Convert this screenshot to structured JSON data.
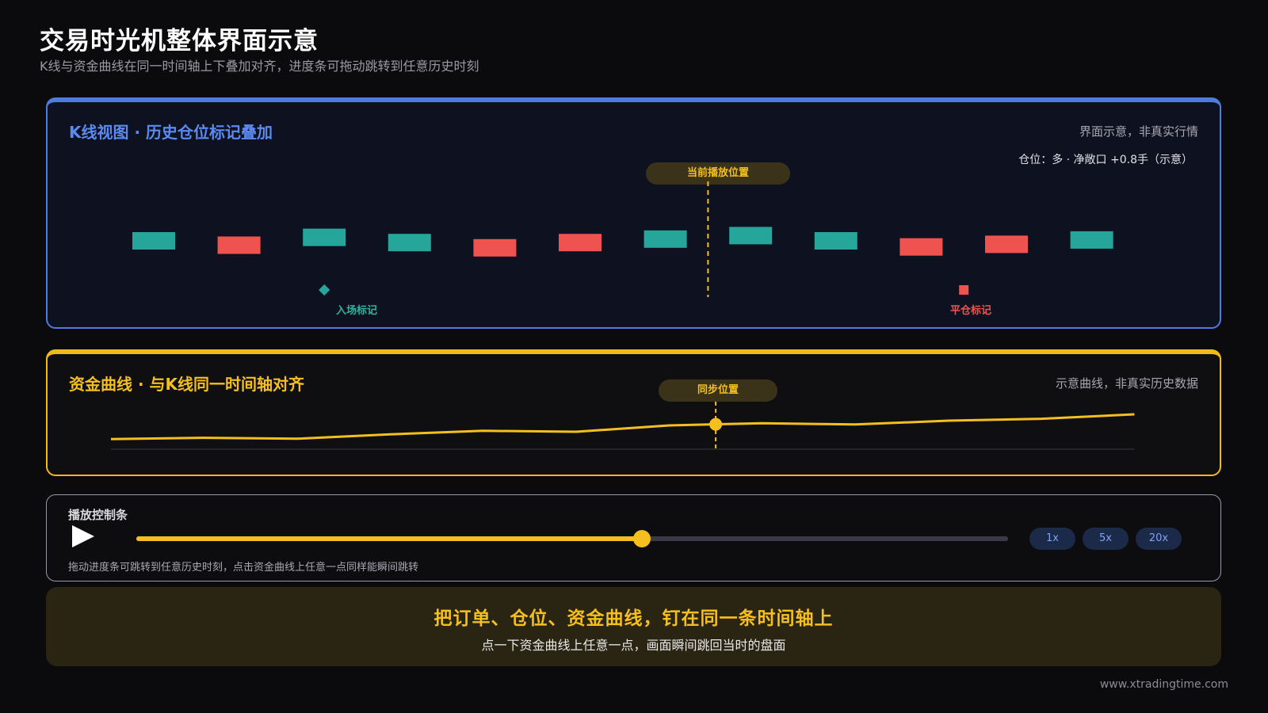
{
  "header": {
    "title": "交易时光机整体界面示意",
    "subtitle": "K线与资金曲线在同一时间轴上下叠加对齐，进度条可拖动跳转到任意历史时刻"
  },
  "kline_panel": {
    "title": "K线视图 · 历史仓位标记叠加",
    "note": "界面示意，非真实行情",
    "position_info": "仓位：多 · 净敞口 +0.8手（示意）",
    "playhead_label": "当前播放位置",
    "entry_label": "入场标记",
    "exit_label": "平仓标记",
    "candles": [
      {
        "dir": "up",
        "open": 0.4,
        "close": 0.6
      },
      {
        "dir": "down",
        "open": 0.55,
        "close": 0.35
      },
      {
        "dir": "up",
        "open": 0.44,
        "close": 0.64
      },
      {
        "dir": "up",
        "open": 0.38,
        "close": 0.58
      },
      {
        "dir": "down",
        "open": 0.52,
        "close": 0.32
      },
      {
        "dir": "down",
        "open": 0.58,
        "close": 0.38
      },
      {
        "dir": "up",
        "open": 0.42,
        "close": 0.62
      },
      {
        "dir": "up",
        "open": 0.46,
        "close": 0.66
      },
      {
        "dir": "up",
        "open": 0.4,
        "close": 0.6
      },
      {
        "dir": "down",
        "open": 0.53,
        "close": 0.33
      },
      {
        "dir": "down",
        "open": 0.56,
        "close": 0.36
      },
      {
        "dir": "up",
        "open": 0.41,
        "close": 0.61
      }
    ],
    "playhead_index": 6.5,
    "entry_index": 2,
    "exit_index": 9.5
  },
  "equity_panel": {
    "title": "资金曲线 · 与K线同一时间轴对齐",
    "note": "示意曲线，非真实历史数据",
    "sync_label": "同步位置",
    "curve": [
      0.12,
      0.16,
      0.13,
      0.27,
      0.38,
      0.35,
      0.55,
      0.62,
      0.58,
      0.7,
      0.76,
      0.9
    ],
    "sync_index": 6.5
  },
  "controls": {
    "title": "播放控制条",
    "progress": 0.58,
    "speeds": [
      "1x",
      "5x",
      "20x"
    ],
    "hint": "拖动进度条可跳转到任意历史时刻，点击资金曲线上任意一点同样能瞬间跳转"
  },
  "banner": {
    "headline": "把订单、仓位、资金曲线，钉在同一条时间轴上",
    "subline": "点一下资金曲线上任意一点，画面瞬间跳回当时的盘面"
  },
  "footer": {
    "site": "www.xtradingtime.com"
  },
  "colors": {
    "up": "#26a69a",
    "down": "#ef5350",
    "accent": "#f5bf1e",
    "blue": "#4f7be0"
  }
}
